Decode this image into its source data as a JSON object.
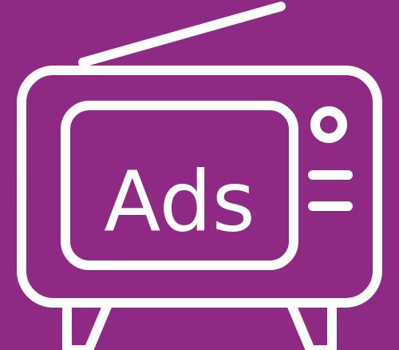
{
  "illustration": {
    "background_color": "#8e2a84",
    "stroke_color": "#ffffff",
    "screen_text": "Ads",
    "icons": {
      "tv": "retro-tv-icon",
      "antenna": "antenna-icon",
      "knob": "knob-icon",
      "speaker": "speaker-slot-icon",
      "legs": "tv-leg-icon"
    }
  }
}
